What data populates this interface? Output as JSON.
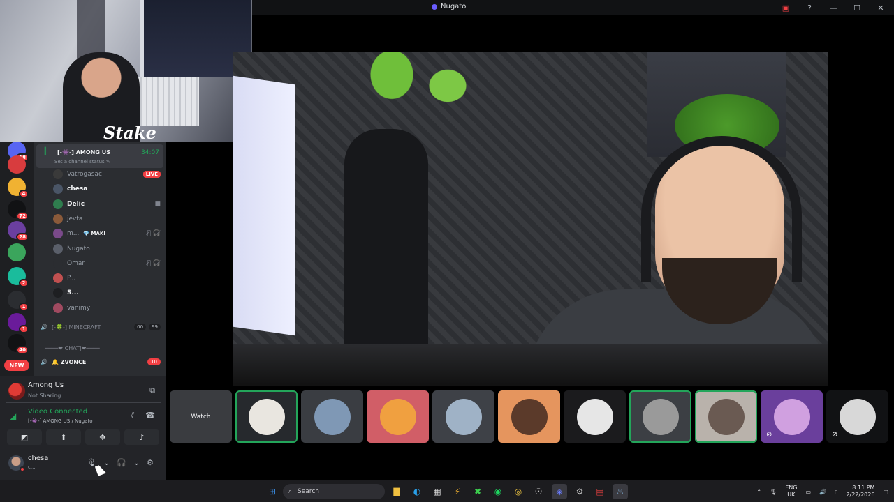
{
  "titlebar": {
    "title": "Nugato"
  },
  "webcam": {
    "logo": "Stake"
  },
  "rail": {
    "servers": [
      {
        "badge": "18",
        "color": "#5865f2"
      },
      {
        "badge": "",
        "color": "#d83c3e"
      },
      {
        "badge": "4",
        "color": "#f0b232"
      },
      {
        "badge": "72",
        "color": "#111214"
      },
      {
        "badge": "28",
        "color": "#6b3fa0"
      },
      {
        "badge": "",
        "color": "#3ba55c"
      },
      {
        "badge": "2",
        "color": "#1abc9c"
      },
      {
        "badge": "1",
        "color": "#2b2d31"
      },
      {
        "badge": "1",
        "color": "#6a1b9a"
      },
      {
        "badge": "40",
        "color": "#111214"
      }
    ],
    "new_label": "NEW"
  },
  "voice_channel": {
    "name": "[-👾-] AMONG US",
    "time": "34:07",
    "status_placeholder": "Set a channel status ✎",
    "members": [
      {
        "name": "Vatrogasac",
        "badge": "LIVE",
        "bright": false,
        "color": "#3a3a3a"
      },
      {
        "name": "chesa",
        "badge": "",
        "bright": true,
        "color": "#4a5566"
      },
      {
        "name": "Delic",
        "badge": "",
        "bright": true,
        "color": "#2f7d4e",
        "icon": "■"
      },
      {
        "name": "jevta",
        "badge": "",
        "bright": false,
        "color": "#8a5a3a"
      },
      {
        "name": "m...",
        "tag": "💎 MAKI",
        "bright": false,
        "color": "#7a4a8a",
        "icons": "🎙̸ 🎧̸"
      },
      {
        "name": "Nugato",
        "badge": "",
        "bright": false,
        "color": "#5a5f6a"
      },
      {
        "name": "Omar",
        "badge": "",
        "bright": false,
        "color": "#2b2d31",
        "icons": "🎙̸ 🎧̸"
      },
      {
        "name": "P...",
        "badge": "",
        "bright": false,
        "color": "#c05050"
      },
      {
        "name": "S...",
        "badge": "",
        "bright": true,
        "color": "#1e1f22"
      },
      {
        "name": "vanimy",
        "badge": "",
        "bright": false,
        "color": "#a04a60"
      }
    ]
  },
  "channels": [
    {
      "icon": "🔊",
      "name": "[-🍀-] MINECRAFT",
      "pills": [
        "00",
        "99"
      ],
      "bold": false
    },
    {
      "icon": "",
      "name": "────❤|CHAT|❤────",
      "pills": [],
      "bold": false
    },
    {
      "icon": "🔊",
      "name": "🔔 ZVONCE",
      "pills": [
        "10"
      ],
      "bold": true
    }
  ],
  "activity": {
    "title": "Among Us",
    "subtitle": "Not Sharing"
  },
  "voice_status": {
    "title": "Video Connected",
    "subtitle": "[-👾-] AMONG US / Nugato"
  },
  "user": {
    "name": "chesa",
    "status": "c..."
  },
  "video_strip": {
    "watch_label": "Watch",
    "tiles": [
      {
        "name": "tile-watch",
        "bg": "#3a3c40",
        "speaking": false
      },
      {
        "name": "tile-mask",
        "bg": "#26292d",
        "speaking": true,
        "ava": "#e9e6e0"
      },
      {
        "name": "tile-user-1",
        "bg": "#3a3d42",
        "ava": "#7f98b5",
        "speaking": false
      },
      {
        "name": "tile-goku",
        "bg": "#d15e67",
        "ava": "#f0a040",
        "speaking": false
      },
      {
        "name": "tile-user-2",
        "bg": "#3e4147",
        "ava": "#9fb2c6",
        "speaking": false
      },
      {
        "name": "tile-user-3",
        "bg": "#e5955e",
        "ava": "#5b3a2a",
        "speaking": false
      },
      {
        "name": "tile-user-4",
        "bg": "#1b1b1d",
        "ava": "#e6e6e6",
        "speaking": false
      },
      {
        "name": "tile-camera",
        "bg": "#3c3f44",
        "ava": "#9a9a9a",
        "speaking": true
      },
      {
        "name": "tile-user-5",
        "bg": "#b9b2ab",
        "ava": "#6a5a52",
        "speaking": true
      },
      {
        "name": "tile-purple",
        "bg": "#6a3f9c",
        "ava": "#d0a0e0",
        "speaking": false
      },
      {
        "name": "tile-user-6",
        "bg": "#111214",
        "ava": "#d8d8d8",
        "speaking": false
      }
    ]
  },
  "taskbar": {
    "search_placeholder": "Search",
    "lang": "ENG",
    "region": "UK",
    "time": "8:11 PM",
    "date": "2/22/2026"
  }
}
